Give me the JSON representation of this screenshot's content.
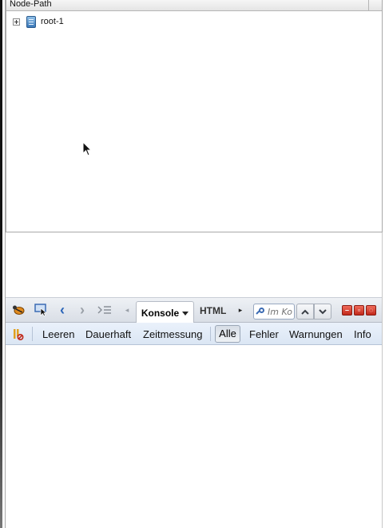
{
  "tree_panel": {
    "column_header": "Node-Path",
    "nodes": [
      {
        "label": "root-1",
        "expanded": false
      }
    ]
  },
  "firebug": {
    "toolbar": {
      "icons": [
        "firebug-icon",
        "inspect-element-icon",
        "back-arrow-icon",
        "forward-arrow-icon",
        "command-line-icon"
      ],
      "active_tab": "Konsole",
      "tabs": [
        "Konsole",
        "HTML"
      ],
      "search_placeholder": "Im Ko",
      "window_buttons": [
        "minimize",
        "detach",
        "close"
      ]
    },
    "console_bar": {
      "actions": [
        "Leeren",
        "Dauerhaft",
        "Zeitmessung"
      ],
      "filters": [
        "Alle",
        "Fehler",
        "Warnungen",
        "Info"
      ],
      "active_filter": "Alle"
    }
  },
  "colors": {
    "window_close_red": "#d13a2a",
    "nav_blue": "#2a64b8"
  }
}
